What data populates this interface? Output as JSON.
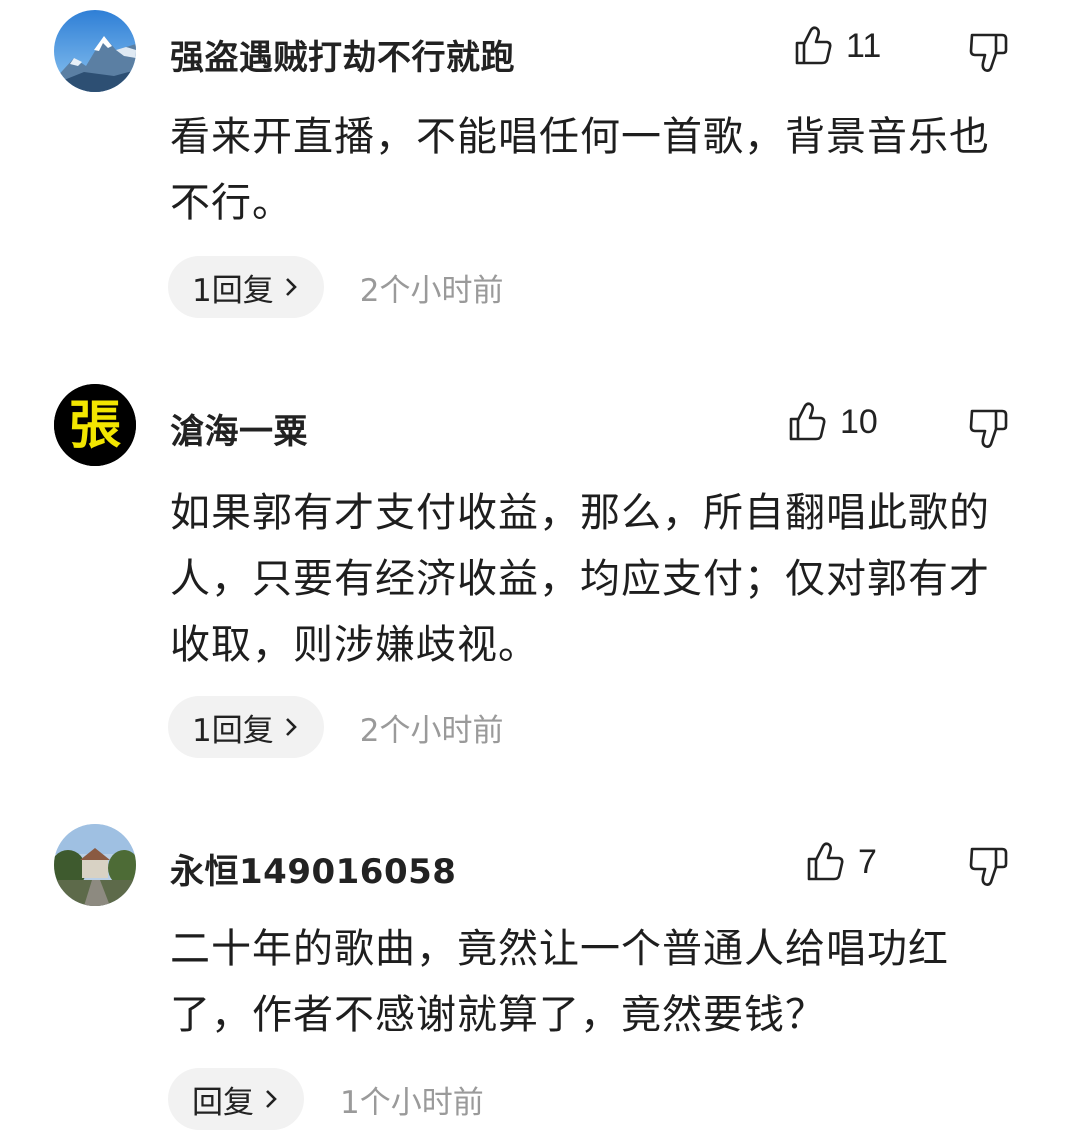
{
  "comments": [
    {
      "avatar": "mountain-avatar",
      "username": "强盗遇贼打劫不行就跑",
      "likes": "11",
      "text_lines": [
        "看来开直播，不能唱任何一首歌，背景音乐也",
        "不行。"
      ],
      "reply_label": "1回复",
      "time": "2个小时前"
    },
    {
      "avatar": "zhang-character-avatar",
      "avatar_char": "張",
      "username": "滄海一粟",
      "likes": "10",
      "text_lines": [
        "如果郭有才支付收益，那么，所自翻唱此歌的",
        "人，只要有经济收益，均应支付；仅对郭有才",
        "收取，则涉嫌歧视。"
      ],
      "reply_label": "1回复",
      "time": "2个小时前"
    },
    {
      "avatar": "landscape-avatar",
      "username": "永恒149016058",
      "likes": "7",
      "text_lines": [
        "二十年的歌曲，竟然让一个普通人给唱功红",
        "了，作者不感谢就算了，竟然要钱？"
      ],
      "reply_label": "回复",
      "time": "1个小时前"
    }
  ],
  "icons": {
    "like": "thumbs-up-icon",
    "dislike": "thumbs-down-icon",
    "chevron": "chevron-right-icon"
  },
  "colors": {
    "reply_pill_bg": "#f2f2f2",
    "time_text": "#9a9a9a",
    "zhang_text": "#f2e600"
  }
}
